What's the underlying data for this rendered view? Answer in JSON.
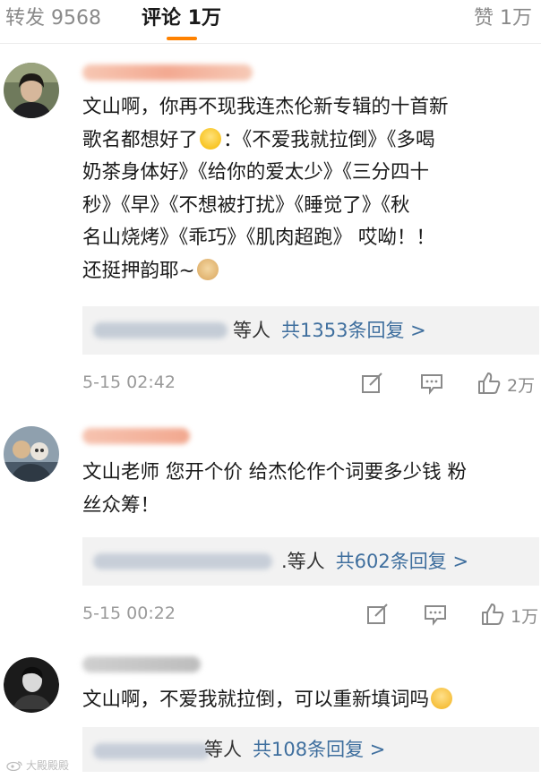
{
  "tabs": {
    "repost": "转发 9568",
    "comments": "评论 1万",
    "likes": "赞 1万"
  },
  "accent_color": "#ff8200",
  "link_color": "#3f6f9e",
  "comments": [
    {
      "lines": [
        "文山啊，你再不现我连杰伦新专辑的十首新",
        "歌名都想好了",
        "：《不爱我就拉倒》《多喝",
        "奶茶身体好》《给你的爱太少》《三分四十",
        "秒》《早》《不想被打扰》《睡觉了》《秋",
        "名山烧烤》《乖巧》《肌肉超跑》 哎呦！！",
        "还挺押韵耶~"
      ],
      "emojis": [
        "laugh-cry-emoji",
        "doge-emoji"
      ],
      "reply_etc": "等人",
      "reply_count": "共1353条回复 >",
      "time": "5-15 02:42",
      "likes": "2万"
    },
    {
      "lines": [
        "文山老师 您开个价 给杰伦作个词要多少钱 粉",
        "丝众筹！"
      ],
      "reply_etc": ".等人",
      "reply_count": "共602条回复 >",
      "time": "5-15 00:22",
      "likes": "1万"
    },
    {
      "lines": [
        "文山啊，不爱我就拉倒，可以重新填词吗"
      ],
      "emojis": [
        "speechless-emoji"
      ],
      "reply_etc": "等人",
      "reply_count": "共108条回复 >"
    }
  ],
  "watermark": "大殿殿殿"
}
